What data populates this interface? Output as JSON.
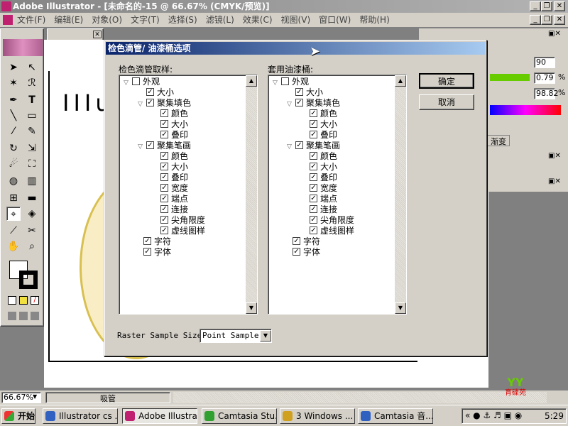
{
  "app": {
    "title": "Adobe Illustrator - [未命名的-15 @ 66.67% (CMYK/预览)]"
  },
  "menu": [
    "文件(F)",
    "编辑(E)",
    "对象(O)",
    "文字(T)",
    "选择(S)",
    "滤镜(L)",
    "效果(C)",
    "视图(V)",
    "窗口(W)",
    "帮助(H)"
  ],
  "canvas_text": "IIIu",
  "dialog": {
    "title": "检色滴管/ 油漆桶选项",
    "left_label": "检色滴管取样:",
    "right_label": "套用油漆桶:",
    "ok": "确定",
    "cancel": "取消",
    "raster_label": "Raster Sample Size:",
    "raster_value": "Point Sample",
    "items": [
      "外观",
      "大小",
      "聚集填色",
      "颜色",
      "大小",
      "叠印",
      "聚集笔画",
      "颜色",
      "大小",
      "叠印",
      "宽度",
      "端点",
      "连接",
      "尖角限度",
      "虚线图样",
      "字符",
      "字体"
    ]
  },
  "right_panel": {
    "v1": "90",
    "v2": "0.79",
    "v3": "98.82",
    "unit": "%",
    "tab": "渐变"
  },
  "status": {
    "zoom": "66.67%",
    "tool": "吸管"
  },
  "taskbar": {
    "start": "开始",
    "items": [
      "Illustrator cs ...",
      "Adobe Illustra...",
      "Camtasia Stu...",
      "3 Windows ...",
      "Camtasia 音..."
    ],
    "clock": "5:29"
  },
  "watermark": "育碟苑",
  "colors": {
    "dialog_title": "#0a246a",
    "gradient_start": "#a6caf0",
    "accent_green": "#66cc00"
  }
}
